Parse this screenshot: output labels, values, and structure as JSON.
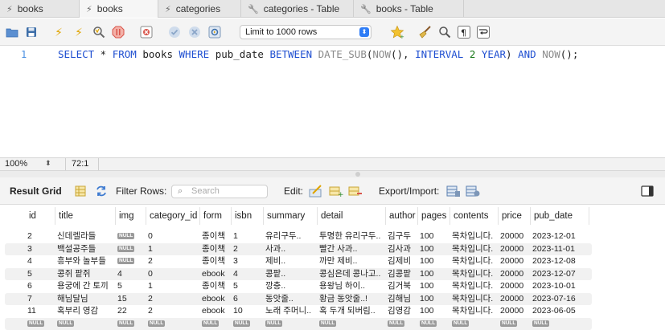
{
  "tabs": [
    {
      "label": "books",
      "icon": "lightning-icon",
      "active": false
    },
    {
      "label": "books",
      "icon": "lightning-icon",
      "active": true
    },
    {
      "label": "categories",
      "icon": "lightning-icon",
      "active": false
    },
    {
      "label": "categories - Table",
      "icon": "wrench-icon",
      "active": false
    },
    {
      "label": "books - Table",
      "icon": "wrench-icon",
      "active": false
    }
  ],
  "toolbar": {
    "limit_label": "Limit to 1000 rows"
  },
  "editor": {
    "line_number": "1",
    "sql_tokens": [
      {
        "t": "SELECT",
        "c": "kw"
      },
      {
        "t": " * ",
        "c": ""
      },
      {
        "t": "FROM",
        "c": "kw"
      },
      {
        "t": " books ",
        "c": ""
      },
      {
        "t": "WHERE",
        "c": "kw"
      },
      {
        "t": " pub_date ",
        "c": ""
      },
      {
        "t": "BETWEEN",
        "c": "kw"
      },
      {
        "t": " ",
        "c": ""
      },
      {
        "t": "DATE_SUB",
        "c": "fn"
      },
      {
        "t": "(",
        "c": ""
      },
      {
        "t": "NOW",
        "c": "fn"
      },
      {
        "t": "(), ",
        "c": ""
      },
      {
        "t": "INTERVAL",
        "c": "kw"
      },
      {
        "t": " ",
        "c": ""
      },
      {
        "t": "2",
        "c": "num"
      },
      {
        "t": " ",
        "c": ""
      },
      {
        "t": "YEAR",
        "c": "kw"
      },
      {
        "t": ") ",
        "c": ""
      },
      {
        "t": "AND",
        "c": "kw"
      },
      {
        "t": " ",
        "c": ""
      },
      {
        "t": "NOW",
        "c": "fn"
      },
      {
        "t": "();",
        "c": ""
      }
    ]
  },
  "status": {
    "zoom": "100%",
    "cursor": "72:1"
  },
  "results": {
    "result_grid_label": "Result Grid",
    "filter_label": "Filter Rows:",
    "search_placeholder": "Search",
    "edit_label": "Edit:",
    "export_label": "Export/Import:",
    "null_text": "NULL",
    "columns": [
      "id",
      "title",
      "img",
      "category_id",
      "form",
      "isbn",
      "summary",
      "detail",
      "author",
      "pages",
      "contents",
      "price",
      "pub_date"
    ],
    "rows": [
      [
        "2",
        "신데렐라들",
        null,
        "0",
        "종이책",
        "1",
        "유리구두..",
        "투명한 유리구두..",
        "김구두",
        "100",
        "목차입니다.",
        "20000",
        "2023-12-01"
      ],
      [
        "3",
        "백설공주들",
        null,
        "1",
        "종이책",
        "2",
        "사과..",
        "빨간 사과..",
        "김사과",
        "100",
        "목차입니다.",
        "20000",
        "2023-11-01"
      ],
      [
        "4",
        "흥부와 놀부들",
        null,
        "2",
        "종이책",
        "3",
        "제비..",
        "까만 제비..",
        "김제비",
        "100",
        "목차입니다.",
        "20000",
        "2023-12-08"
      ],
      [
        "5",
        "콩쥐 팥쥐",
        "4",
        "0",
        "ebook",
        "4",
        "콩팥..",
        "콩심은데 콩나고..",
        "김콩팥",
        "100",
        "목차입니다.",
        "20000",
        "2023-12-07"
      ],
      [
        "6",
        "용궁에 간 토끼",
        "5",
        "1",
        "종이책",
        "5",
        "깡충..",
        "용왕님 하이..",
        "김거북",
        "100",
        "목차입니다.",
        "20000",
        "2023-10-01"
      ],
      [
        "7",
        "해님달님",
        "15",
        "2",
        "ebook",
        "6",
        "동앗줄..",
        "황금 동앗줄..!",
        "김해님",
        "100",
        "목차입니다.",
        "20000",
        "2023-07-16"
      ],
      [
        "11",
        "혹부리 영감",
        "22",
        "2",
        "ebook",
        "10",
        "노래 주머니..",
        "혹 두개 되버림..",
        "김영감",
        "100",
        "목차입니다.",
        "20000",
        "2023-06-05"
      ],
      [
        null,
        null,
        null,
        null,
        null,
        null,
        null,
        null,
        null,
        null,
        null,
        null,
        null
      ]
    ]
  }
}
